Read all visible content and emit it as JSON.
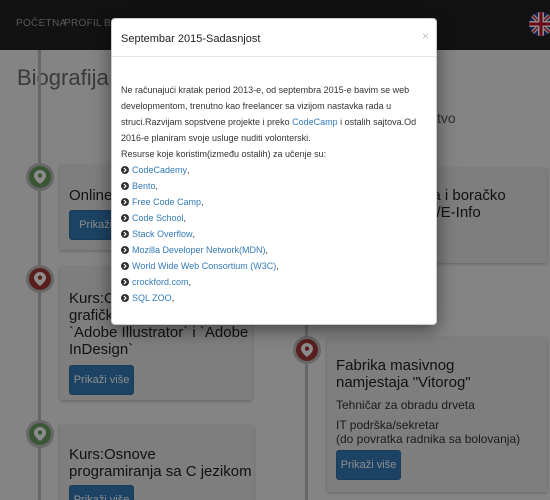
{
  "navbar": {
    "items": [
      {
        "label": "POČETNA"
      },
      {
        "label": "PROFIL"
      },
      {
        "label": "B"
      }
    ]
  },
  "page": {
    "title": "Biografija",
    "right_heading": "tvo"
  },
  "left_cards": [
    {
      "title": "Online",
      "button": "Prikaži v"
    },
    {
      "title": "Kurs:O\ngrafičk\n`Adobe Illustrator` i `Adobe\nInDesign`",
      "button": "Prikaži više"
    },
    {
      "title": "Kurs:Osnove\nprogramiranja sa C jezikom",
      "button": "Prikaži više"
    }
  ],
  "right_cards": [
    {
      "title": "da i boračko\nte/E-Info"
    },
    {
      "title": "Fabrika masivnog\nnamjestaja \"Vitorog\"",
      "line1": "Tehničar za obradu drveta",
      "line2": "IT podrška/sekretar\n(do povratka radnika sa bolovanja)",
      "button": "Prikaži više"
    }
  ],
  "modal": {
    "title": "Septembar 2015-Sadasnjost",
    "close": "×",
    "para_before_link": "Ne računajući kratak period 2013-e, od septembra 2015-e bavim se web developmentom, trenutno kao freelancer sa vizijom nastavka rada u struci.Razvijam sopstvene projekte i preko ",
    "para_link": "CodeCamp",
    "para_after_link": " i ostalih sajtova.Od 2016-e planiram svoje usluge nuditi volonterski.",
    "resources_intro": "Resurse koje koristim(između ostalih) za učenje su:",
    "resources": [
      "CodeCademy",
      "Bento",
      "Free Code Camp",
      "Code School",
      "Stack Overflow",
      "Mozilla Developer Network(MDN)",
      "World Wide Web Consortium (W3C)",
      "crockford.com",
      "SQL ZOO"
    ]
  },
  "colors": {
    "navbar": "#222222",
    "link": "#337ab7",
    "marker_green": "#6b9d62",
    "marker_red": "#a33a3a"
  }
}
